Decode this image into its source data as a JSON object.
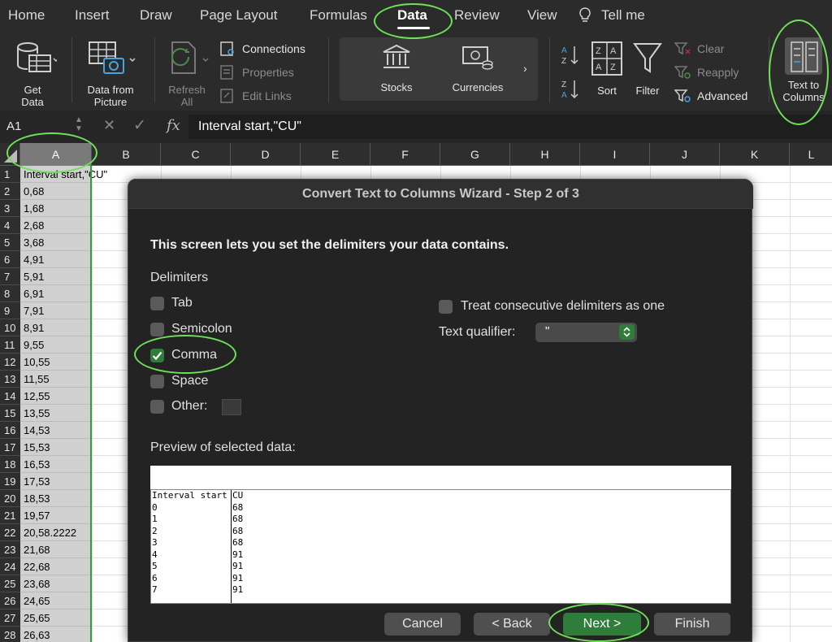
{
  "ribbon_tabs": [
    {
      "label": "Home"
    },
    {
      "label": "Insert"
    },
    {
      "label": "Draw"
    },
    {
      "label": "Page Layout"
    },
    {
      "label": "Formulas"
    },
    {
      "label": "Data"
    },
    {
      "label": "Review"
    },
    {
      "label": "View"
    },
    {
      "label": "Tell me"
    }
  ],
  "ribbon": {
    "get_data": "Get\nData",
    "data_from_picture": "Data from\nPicture",
    "refresh_all": "Refresh\nAll",
    "connections": "Connections",
    "properties": "Properties",
    "edit_links": "Edit Links",
    "stocks": "Stocks",
    "currencies": "Currencies",
    "sort": "Sort",
    "filter": "Filter",
    "clear": "Clear",
    "reapply": "Reapply",
    "advanced": "Advanced",
    "text_to_columns": "Text to\nColumns"
  },
  "formula_bar": {
    "name_box": "A1",
    "fx": "fx",
    "content": "Interval start,\"CU\""
  },
  "grid": {
    "columns": [
      "A",
      "B",
      "C",
      "D",
      "E",
      "F",
      "G",
      "H",
      "I",
      "J",
      "K",
      "L"
    ],
    "rows": [
      {
        "n": "1",
        "a": "Interval start,\"CU\""
      },
      {
        "n": "2",
        "a": "0,68"
      },
      {
        "n": "3",
        "a": "1,68"
      },
      {
        "n": "4",
        "a": "2,68"
      },
      {
        "n": "5",
        "a": "3,68"
      },
      {
        "n": "6",
        "a": "4,91"
      },
      {
        "n": "7",
        "a": "5,91"
      },
      {
        "n": "8",
        "a": "6,91"
      },
      {
        "n": "9",
        "a": "7,91"
      },
      {
        "n": "10",
        "a": "8,91"
      },
      {
        "n": "11",
        "a": "9,55"
      },
      {
        "n": "12",
        "a": "10,55"
      },
      {
        "n": "13",
        "a": "11,55"
      },
      {
        "n": "14",
        "a": "12,55"
      },
      {
        "n": "15",
        "a": "13,55"
      },
      {
        "n": "16",
        "a": "14,53"
      },
      {
        "n": "17",
        "a": "15,53"
      },
      {
        "n": "18",
        "a": "16,53"
      },
      {
        "n": "19",
        "a": "17,53"
      },
      {
        "n": "20",
        "a": "18,53"
      },
      {
        "n": "21",
        "a": "19,57"
      },
      {
        "n": "22",
        "a": "20,58.2222"
      },
      {
        "n": "23",
        "a": "21,68"
      },
      {
        "n": "24",
        "a": "22,68"
      },
      {
        "n": "25",
        "a": "23,68"
      },
      {
        "n": "26",
        "a": "24,65"
      },
      {
        "n": "27",
        "a": "25,65"
      },
      {
        "n": "28",
        "a": "26,63"
      }
    ]
  },
  "dialog": {
    "title": "Convert Text to Columns Wizard - Step 2 of 3",
    "heading": "This screen lets you set the delimiters your data contains.",
    "delimiters_label": "Delimiters",
    "tab": "Tab",
    "semicolon": "Semicolon",
    "comma": "Comma",
    "space": "Space",
    "other": "Other:",
    "treat_consecutive": "Treat consecutive delimiters as one",
    "text_qualifier_label": "Text qualifier:",
    "text_qualifier_value": "\"",
    "preview_label": "Preview of selected data:",
    "preview_col1": [
      "Interval start",
      "0",
      "1",
      "2",
      "3",
      "4",
      "5",
      "6",
      "7"
    ],
    "preview_col2": [
      "CU",
      "68",
      "68",
      "68",
      "68",
      "91",
      "91",
      "91",
      "91"
    ],
    "cancel": "Cancel",
    "back": "< Back",
    "next": "Next >",
    "finish": "Finish"
  },
  "colors": {
    "accent_green": "#2f7d3a",
    "highlight_ring": "#6fe05a"
  }
}
